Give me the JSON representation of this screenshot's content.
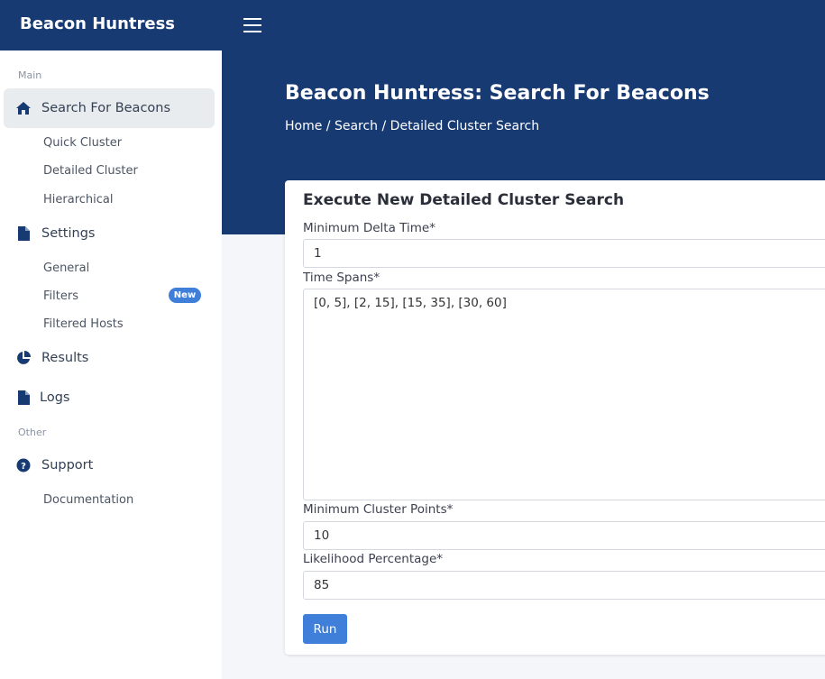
{
  "app": {
    "brand": "Beacon Huntress"
  },
  "sidebar": {
    "section_main": "Main",
    "section_other": "Other",
    "search": {
      "label": "Search For Beacons",
      "icon": "home-icon"
    },
    "search_items": [
      "Quick Cluster",
      "Detailed Cluster",
      "Hierarchical"
    ],
    "settings": {
      "label": "Settings",
      "icon": "file-icon"
    },
    "settings_items": [
      "General",
      "Filters",
      "Filtered Hosts"
    ],
    "filters_badge": "New",
    "results": {
      "label": "Results",
      "icon": "pie-chart-icon"
    },
    "logs": {
      "label": "Logs",
      "icon": "file-icon"
    },
    "support": {
      "label": "Support",
      "icon": "question-circle-icon"
    },
    "support_items": [
      "Documentation"
    ]
  },
  "header": {
    "title": "Beacon Huntress: Search For Beacons",
    "breadcrumb": "Home / Search / Detailed Cluster Search"
  },
  "form": {
    "title": "Execute New Detailed Cluster Search",
    "min_delta_label": "Minimum Delta Time*",
    "min_delta_value": "1",
    "time_spans_label": "Time Spans*",
    "time_spans_value": "[0, 5], [2, 15], [15, 35], [30, 60]",
    "min_cluster_label": "Minimum Cluster Points*",
    "min_cluster_value": "10",
    "likelihood_label": "Likelihood Percentage*",
    "likelihood_value": "85",
    "run_label": "Run"
  },
  "colors": {
    "navy": "#173a73",
    "accent": "#3f7fd9"
  }
}
